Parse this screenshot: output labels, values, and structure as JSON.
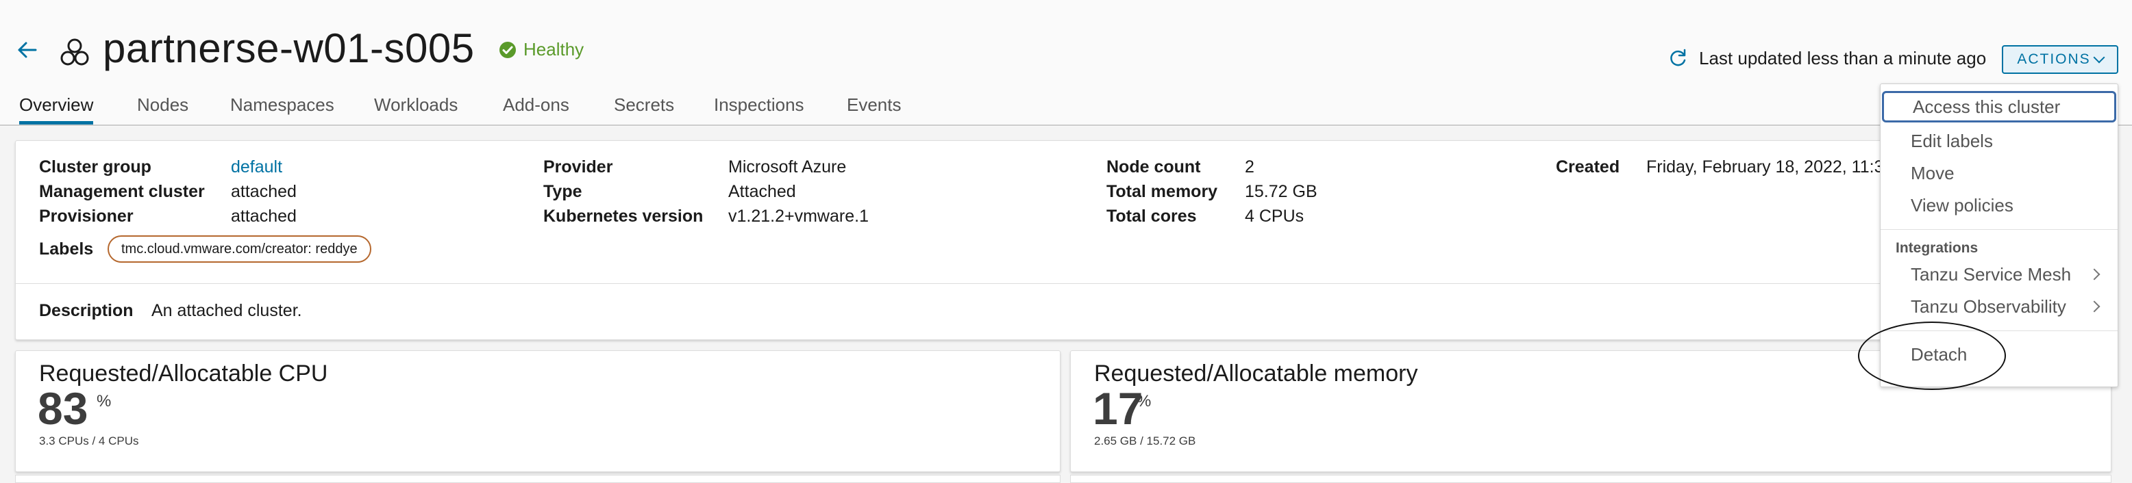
{
  "header": {
    "title": "partnerse-w01-s005",
    "health": "Healthy",
    "last_updated": "Last updated less than a minute ago",
    "actions_label": "ACTIONS"
  },
  "tabs": [
    {
      "label": "Overview",
      "active": true
    },
    {
      "label": "Nodes"
    },
    {
      "label": "Namespaces"
    },
    {
      "label": "Workloads"
    },
    {
      "label": "Add-ons"
    },
    {
      "label": "Secrets"
    },
    {
      "label": "Inspections"
    },
    {
      "label": "Events"
    }
  ],
  "summary": {
    "cluster_group_label": "Cluster group",
    "cluster_group_value": "default",
    "management_cluster_label": "Management cluster",
    "management_cluster_value": "attached",
    "provisioner_label": "Provisioner",
    "provisioner_value": "attached",
    "labels_label": "Labels",
    "label_pill": "tmc.cloud.vmware.com/creator: reddye",
    "provider_label": "Provider",
    "provider_value": "Microsoft Azure",
    "type_label": "Type",
    "type_value": "Attached",
    "k8s_version_label": "Kubernetes version",
    "k8s_version_value": "v1.21.2+vmware.1",
    "node_count_label": "Node count",
    "node_count_value": "2",
    "total_memory_label": "Total memory",
    "total_memory_value": "15.72 GB",
    "total_cores_label": "Total cores",
    "total_cores_value": "4 CPUs",
    "created_label": "Created",
    "created_value": "Friday, February 18, 2022, 11:3",
    "description_label": "Description",
    "description_value": "An attached cluster."
  },
  "metrics": {
    "cpu": {
      "title": "Requested/Allocatable CPU",
      "value": "83",
      "unit": "%",
      "sub": "3.3 CPUs / 4 CPUs"
    },
    "memory": {
      "title": "Requested/Allocatable memory",
      "value": "17",
      "unit": "%",
      "sub": "2.65 GB / 15.72 GB"
    }
  },
  "menu": {
    "items": [
      "Access this cluster",
      "Edit labels",
      "Move",
      "View policies"
    ],
    "section": "Integrations",
    "integrations": [
      "Tanzu Service Mesh",
      "Tanzu Observability"
    ],
    "detach": "Detach"
  },
  "colors": {
    "accent": "#0072a3",
    "healthy": "#5a9a2a",
    "label_pill_border": "#b5682e"
  }
}
